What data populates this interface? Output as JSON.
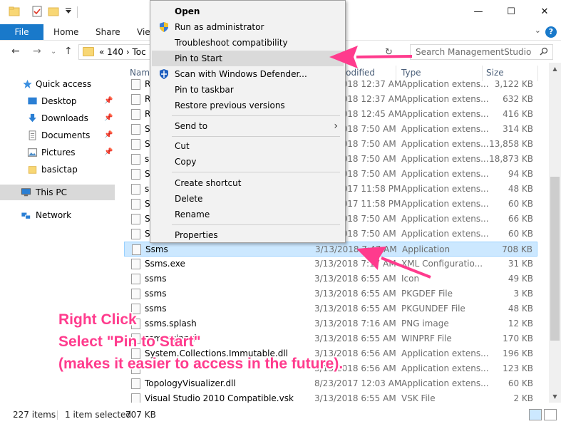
{
  "titlebar": {
    "minimize_glyph": "—",
    "maximize_glyph": "☐",
    "close_glyph": "✕"
  },
  "ribbon": {
    "tabs": [
      "File",
      "Home",
      "Share",
      "View"
    ],
    "help_glyph": "?",
    "chevron_glyph": "⌄"
  },
  "navbar": {
    "back_glyph": "←",
    "forward_glyph": "→",
    "recent_glyph": "⌄",
    "up_glyph": "↑",
    "address_crumbs": "«  140  ›  Toc",
    "search_placeholder": "Search ManagementStudio",
    "refresh_glyph": "↻"
  },
  "sidebar": {
    "quick_access": "Quick access",
    "items": [
      {
        "label": "Desktop",
        "pinned": true
      },
      {
        "label": "Downloads",
        "pinned": true
      },
      {
        "label": "Documents",
        "pinned": true
      },
      {
        "label": "Pictures",
        "pinned": true
      },
      {
        "label": "basictap",
        "pinned": false
      }
    ],
    "this_pc": "This PC",
    "network": "Network",
    "pin_glyph": "📌"
  },
  "columns": {
    "name": "Name",
    "date": "Date modified",
    "type": "Type",
    "size": "Size"
  },
  "files": [
    {
      "name": "R",
      "date": "3/13/2018 12:37 AM",
      "type": "Application extens...",
      "size": "3,122 KB"
    },
    {
      "name": "R",
      "date": "3/13/2018 12:37 AM",
      "type": "Application extens...",
      "size": "632 KB"
    },
    {
      "name": "R",
      "date": "3/13/2018 12:45 AM",
      "type": "Application extens...",
      "size": "416 KB"
    },
    {
      "name": "S",
      "date": "3/13/2018 7:50 AM",
      "type": "Application extens...",
      "size": "314 KB"
    },
    {
      "name": "S",
      "date": "3/13/2018 7:50 AM",
      "type": "Application extens...",
      "size": "13,858 KB"
    },
    {
      "name": "s",
      "date": "3/13/2018 7:50 AM",
      "type": "Application extens...",
      "size": "18,873 KB"
    },
    {
      "name": "S",
      "date": "3/13/2018 7:50 AM",
      "type": "Application extens...",
      "size": "94 KB"
    },
    {
      "name": "s",
      "date": "8/23/2017 11:58 PM",
      "type": "Application extens...",
      "size": "48 KB"
    },
    {
      "name": "S",
      "date": "8/23/2017 11:58 PM",
      "type": "Application extens...",
      "size": "60 KB"
    },
    {
      "name": "S",
      "date": "3/13/2018 7:50 AM",
      "type": "Application extens...",
      "size": "66 KB"
    },
    {
      "name": "S",
      "date": "3/13/2018 7:50 AM",
      "type": "Application extens...",
      "size": "60 KB"
    },
    {
      "name": "Ssms",
      "date": "3/13/2018 7:47 AM",
      "type": "Application",
      "size": "708 KB",
      "selected": true
    },
    {
      "name": "Ssms.exe",
      "date": "3/13/2018 7:17 AM",
      "type": "XML Configuratio...",
      "size": "31 KB"
    },
    {
      "name": "ssms",
      "date": "3/13/2018 6:55 AM",
      "type": "Icon",
      "size": "49 KB"
    },
    {
      "name": "ssms",
      "date": "3/13/2018 6:55 AM",
      "type": "PKGDEF File",
      "size": "3 KB"
    },
    {
      "name": "ssms",
      "date": "3/13/2018 6:55 AM",
      "type": "PKGUNDEF File",
      "size": "48 KB"
    },
    {
      "name": "ssms.splash",
      "date": "3/13/2018 7:16 AM",
      "type": "PNG image",
      "size": "12 KB"
    },
    {
      "name": "ssms.winprf",
      "date": "3/13/2018 6:55 AM",
      "type": "WINPRF File",
      "size": "170 KB"
    },
    {
      "name": "System.Collections.Immutable.dll",
      "date": "3/13/2018 6:56 AM",
      "type": "Application extens...",
      "size": "196 KB"
    },
    {
      "name": "",
      "date": "3/13/2018 6:56 AM",
      "type": "Application extens...",
      "size": "123 KB"
    },
    {
      "name": "TopologyVisualizer.dll",
      "date": "8/23/2017 12:03 AM",
      "type": "Application extens...",
      "size": "60 KB"
    },
    {
      "name": "Visual Studio 2010 Compatible.vsk",
      "date": "3/13/2018 6:55 AM",
      "type": "VSK File",
      "size": "2 KB"
    }
  ],
  "context_menu": {
    "open": "Open",
    "run_as_admin": "Run as administrator",
    "troubleshoot": "Troubleshoot compatibility",
    "pin_to_start": "Pin to Start",
    "scan": "Scan with Windows Defender...",
    "pin_taskbar": "Pin to taskbar",
    "restore": "Restore previous versions",
    "send_to": "Send to",
    "cut": "Cut",
    "copy": "Copy",
    "create_shortcut": "Create shortcut",
    "delete": "Delete",
    "rename": "Rename",
    "properties": "Properties",
    "submenu_glyph": "›"
  },
  "status": {
    "item_count": "227 items",
    "selected": "1 item selected",
    "selected_size": "707 KB"
  },
  "annotation": {
    "line1": "Right Click",
    "line2": "Select \"Pin to Start\"",
    "line3": " (makes it easier to access in the future)."
  },
  "colors": {
    "accent": "#1979ca",
    "annotation": "#ff3b8d",
    "selection": "#cce8ff",
    "folder": "#f8d775"
  }
}
